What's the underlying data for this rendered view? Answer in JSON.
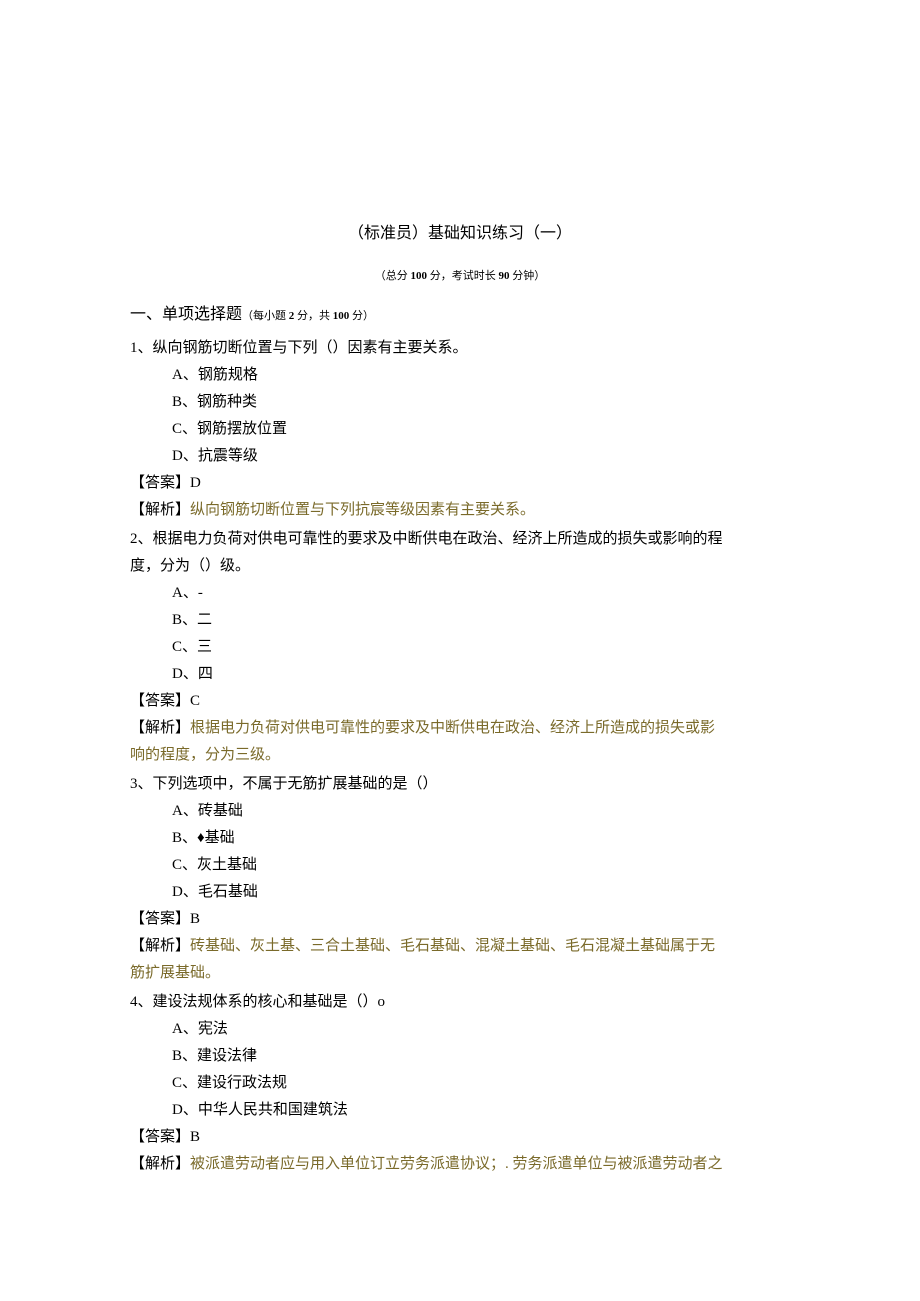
{
  "title": "（标准员）基础知识练习（一）",
  "subtitle_prefix": "（总分 ",
  "subtitle_score": "100",
  "subtitle_mid": " 分，考试时长 ",
  "subtitle_time": "90",
  "subtitle_suffix": " 分钟）",
  "section": {
    "heading": "一、单项选择题",
    "detail_prefix": "（每小题 ",
    "detail_points": "2",
    "detail_mid": " 分，共 ",
    "detail_total": "100",
    "detail_suffix": " 分）"
  },
  "questions": [
    {
      "num": "1、",
      "text": "纵向钢筋切断位置与下列（）因素有主要关系。",
      "options": {
        "A": "A、钢筋规格",
        "B": "B、钢筋种类",
        "C": "C、钢筋摆放位置",
        "D": "D、抗震等级"
      },
      "answer_label": "【答案】",
      "answer": "D",
      "explain_label": "【解析】",
      "explain": "纵向钢筋切断位置与下列抗宸等级因素有主要关系。"
    },
    {
      "num": "2、",
      "text": "根据电力负荷对供电可靠性的要求及中断供电在政治、经济上所造成的损失或影响的程",
      "text_cont": "度，分为（）级。",
      "options": {
        "A": "A、-",
        "B": "B、二",
        "C": "C、三",
        "D": "D、四"
      },
      "answer_label": "【答案】",
      "answer": "C",
      "explain_label": "【解析】",
      "explain": "根据电力负荷对供电可靠性的要求及中断供电在政治、经济上所造成的损失或影",
      "explain_cont": "响的程度，分为三级。"
    },
    {
      "num": "3、",
      "text": "下列选项中，不属于无筋扩展基础的是（）",
      "options": {
        "A": "A、砖基础",
        "B": "B、♦基础",
        "C": "C、灰土基础",
        "D": "D、毛石基础"
      },
      "answer_label": "【答案】",
      "answer": "B",
      "explain_label": "【解析】",
      "explain": "砖基础、灰土基、三合土基础、毛石基础、混凝土基础、毛石混凝土基础属于无",
      "explain_cont": "筋扩展基础。"
    },
    {
      "num": "4、",
      "text": "建设法规体系的核心和基础是（）o",
      "options": {
        "A": "A、宪法",
        "B": "B、建设法律",
        "C": "C、建设行政法规",
        "D": "D、中华人民共和国建筑法"
      },
      "answer_label": "【答案】",
      "answer": "B",
      "explain_label": "【解析】",
      "explain": "被派遣劳动者应与用入单位订立劳务派遣协议；. 劳务派遣单位与被派遣劳动者之"
    }
  ]
}
